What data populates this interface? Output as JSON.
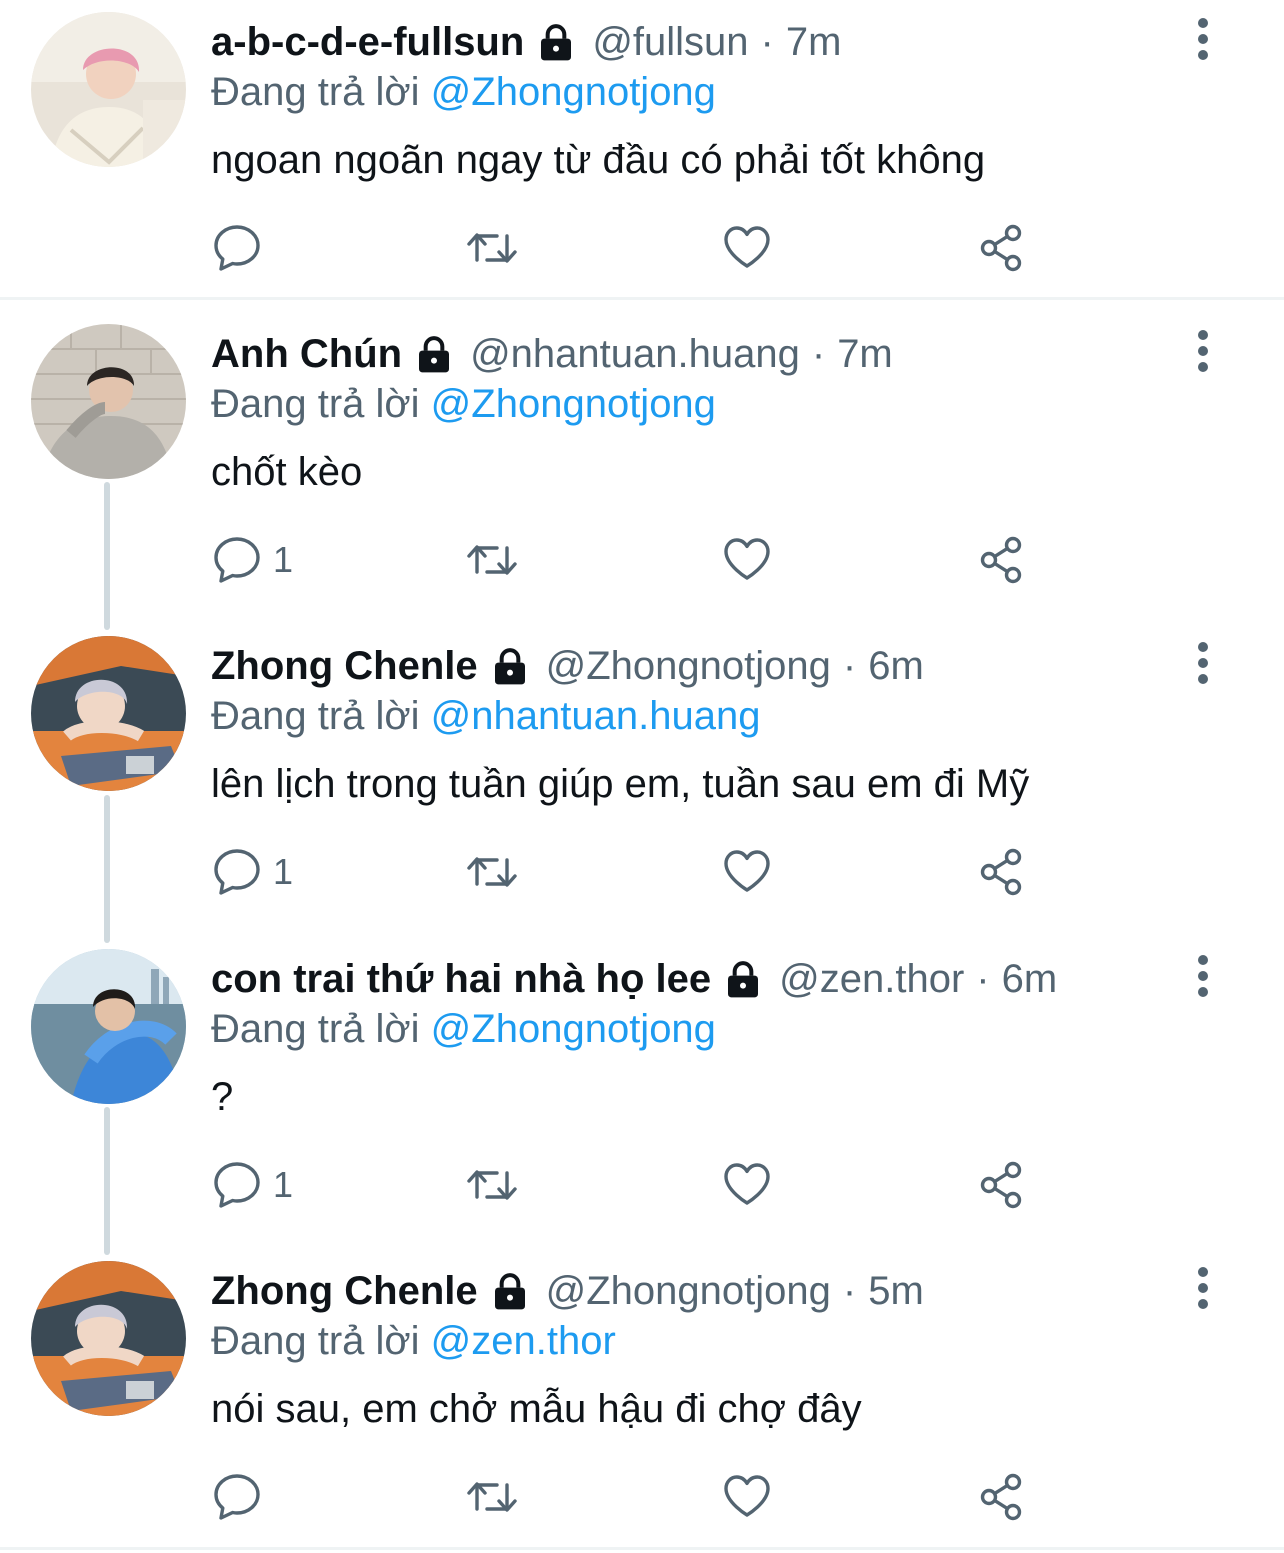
{
  "replying_prefix": "Đang trả lời",
  "separator": "·",
  "colors": {
    "text": "#0f1419",
    "secondary": "#536471",
    "link": "#1d9bf0",
    "divider": "#eff3f4",
    "thread_line": "#cfd9de"
  },
  "icons": {
    "lock": "lock-icon",
    "more": "more-vertical-icon",
    "reply": "reply-icon",
    "retweet": "retweet-icon",
    "like": "heart-icon",
    "share": "share-icon"
  },
  "tweets": [
    {
      "name": "a-b-c-d-e-fullsun",
      "handle": "@fullsun",
      "time": "7m",
      "replying_to": "@Zhongnotjong",
      "text": "ngoan ngoãn ngay từ đầu có phải tốt không",
      "reply_count": ""
    },
    {
      "name": "Anh Chún",
      "handle": "@nhantuan.huang",
      "time": "7m",
      "replying_to": "@Zhongnotjong",
      "text": "chốt kèo",
      "reply_count": "1"
    },
    {
      "name": "Zhong Chenle",
      "handle": "@Zhongnotjong",
      "time": "6m",
      "replying_to": "@nhantuan.huang",
      "text": "lên lịch trong tuần giúp em, tuần sau em đi Mỹ",
      "reply_count": "1"
    },
    {
      "name": "con trai thứ hai nhà họ lee",
      "handle": "@zen.thor",
      "time": "6m",
      "replying_to": "@Zhongnotjong",
      "text": "?",
      "reply_count": "1"
    },
    {
      "name": "Zhong Chenle",
      "handle": "@Zhongnotjong",
      "time": "5m",
      "replying_to": "@zen.thor",
      "text": "nói sau, em chở mẫu hậu đi chợ đây",
      "reply_count": ""
    }
  ]
}
